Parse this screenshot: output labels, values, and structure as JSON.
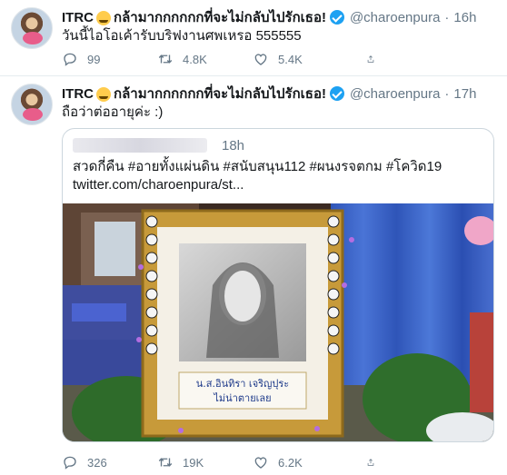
{
  "tweets": [
    {
      "name": "ITRC",
      "headline": "กล้ามากกกกกกที่จะไม่กลับไปรักเธอ!",
      "handle": "@charoenpura",
      "time": "16h",
      "text": "วันนี้ไอโอเค้ารับบริฟงานศพเหรอ 555555",
      "stats": {
        "replies": "99",
        "retweets": "4.8K",
        "likes": "5.4K"
      }
    },
    {
      "name": "ITRC",
      "headline": "กล้ามากกกกกกที่จะไม่กลับไปรักเธอ!",
      "handle": "@charoenpura",
      "time": "17h",
      "text": "ถือว่าต่ออายุค่ะ :)",
      "quote": {
        "time": "18h",
        "text": "สวดกี่คืน #อายทั้งแผ่นดิน #สนับสนุน112 #ผนงรจตกม #โควิด19",
        "link": "twitter.com/charoenpura/st...",
        "image": {
          "card_name": "น.ส.อินทิรา เจริญปุระ",
          "card_caption": "ไม่น่าตายเลย"
        }
      },
      "stats": {
        "replies": "326",
        "retweets": "19K",
        "likes": "6.2K"
      }
    }
  ],
  "icons": [
    "reply-icon",
    "retweet-icon",
    "like-icon",
    "share-icon",
    "verified-icon",
    "emoji-icon",
    "more-icon"
  ],
  "colors": {
    "text": "#14171a",
    "secondary": "#657786",
    "verified": "#1da1f2",
    "border": "#e6ecf0"
  }
}
